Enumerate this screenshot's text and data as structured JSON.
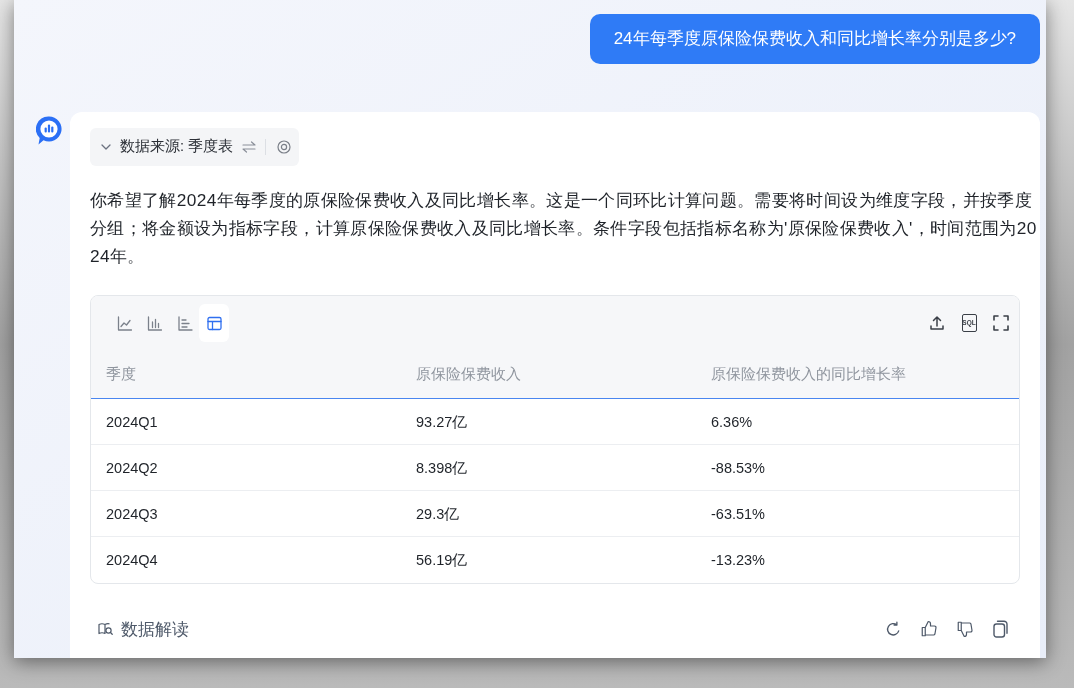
{
  "question": "24年每季度原保险保费收入和同比增长率分别是多少?",
  "answer": {
    "source_label": "数据来源: 季度表",
    "summary": "你希望了解2024年每季度的原保险保费收入及同比增长率。这是一个同环比计算问题。需要将时间设为维度字段，并按季度分组；将金额设为指标字段，计算原保险保费收入及同比增长率。条件字段包括指标名称为'原保险保费收入'，时间范围为2024年。",
    "result": {
      "view_tabs": [
        {
          "kind": "line",
          "selected": false
        },
        {
          "kind": "bar",
          "selected": false
        },
        {
          "kind": "hbar",
          "selected": false
        },
        {
          "kind": "table",
          "selected": true
        }
      ],
      "sql_label": "SQL",
      "table": {
        "columns": [
          "季度",
          "原保险保费收入",
          "原保险保费收入的同比增长率"
        ],
        "rows": [
          [
            "2024Q1",
            "93.27亿",
            "6.36%"
          ],
          [
            "2024Q2",
            "8.398亿",
            "-88.53%"
          ],
          [
            "2024Q3",
            "29.3亿",
            "-63.51%"
          ],
          [
            "2024Q4",
            "56.19亿",
            "-13.23%"
          ]
        ]
      }
    },
    "interpret_button": "数据解读"
  }
}
